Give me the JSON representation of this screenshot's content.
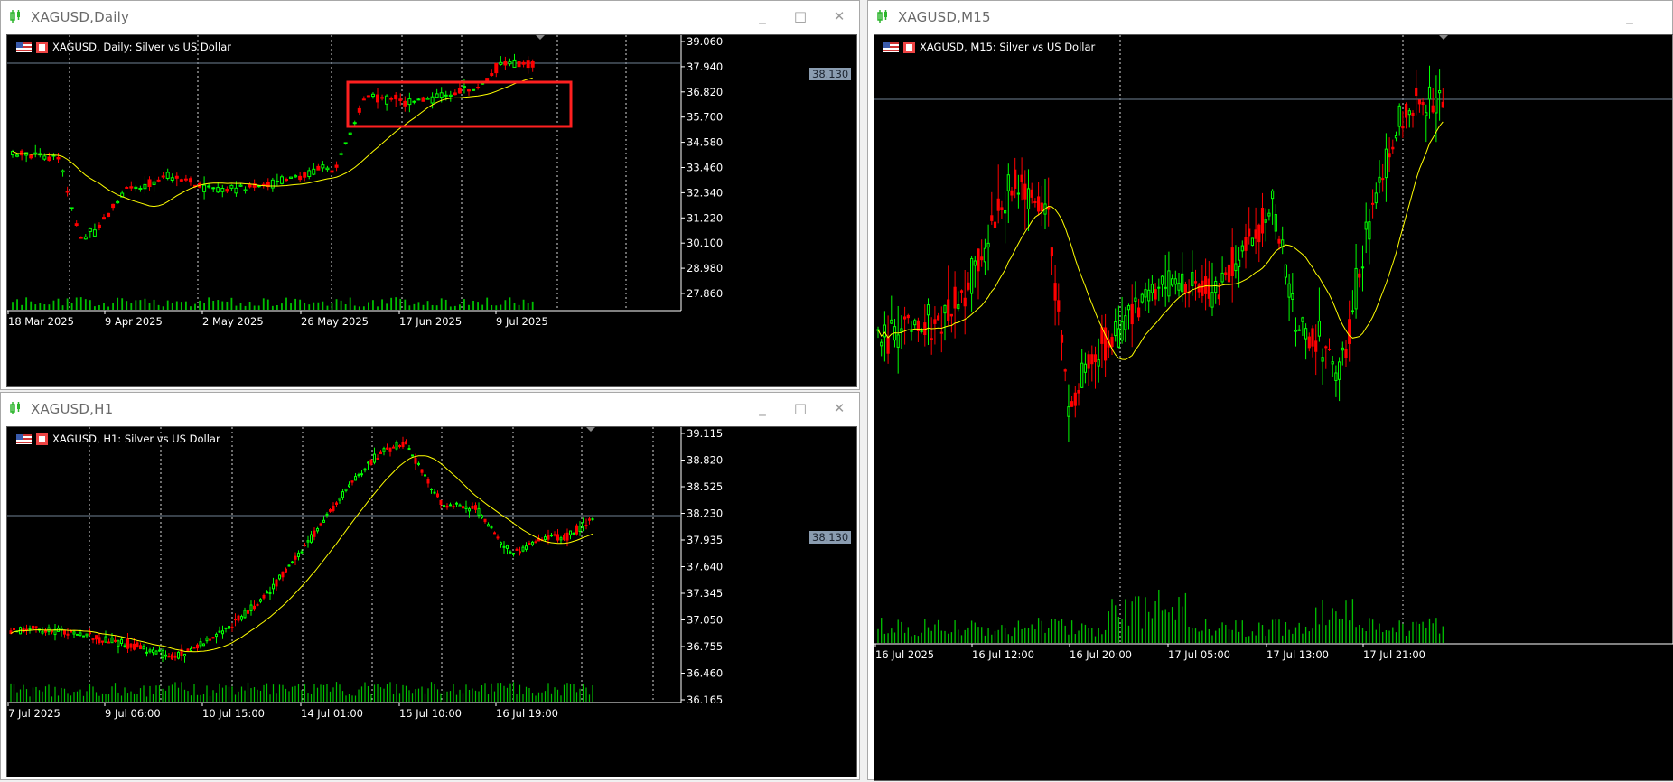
{
  "windows": {
    "daily": {
      "title": "XAGUSD,Daily",
      "label": "XAGUSD, Daily:  Silver vs US Dollar",
      "current_price": "38.130",
      "price_ticks": [
        "39.060",
        "37.940",
        "36.820",
        "35.700",
        "34.580",
        "33.460",
        "32.340",
        "31.220",
        "30.100",
        "28.980",
        "27.860"
      ],
      "time_ticks": [
        "18 Mar 2025",
        "9 Apr 2025",
        "2 May 2025",
        "26 May 2025",
        "17 Jun 2025",
        "9 Jul 2025"
      ]
    },
    "h1": {
      "title": "XAGUSD,H1",
      "label": "XAGUSD, H1:  Silver vs US Dollar",
      "current_price": "38.130",
      "price_ticks": [
        "39.115",
        "38.820",
        "38.525",
        "38.230",
        "37.935",
        "37.640",
        "37.345",
        "37.050",
        "36.755",
        "36.460",
        "36.165"
      ],
      "time_ticks": [
        "7 Jul 2025",
        "9 Jul 06:00",
        "10 Jul 15:00",
        "14 Jul 01:00",
        "15 Jul 10:00",
        "16 Jul 19:00"
      ]
    },
    "m15": {
      "title": "XAGUSD,M15",
      "label": "XAGUSD, M15:  Silver vs US Dollar",
      "time_ticks": [
        "16 Jul 2025",
        "16 Jul 12:00",
        "16 Jul 20:00",
        "17 Jul 05:00",
        "17 Jul 13:00",
        "17 Jul 21:00"
      ]
    }
  },
  "controls": {
    "minimize": "_",
    "maximize": "□",
    "close": "✕"
  },
  "icons": {
    "window": "candle-chart-icon",
    "flag": "us-flag-icon",
    "chart": "chart-type-icon"
  },
  "colors": {
    "bull": "#00ff00",
    "bear": "#ff0000",
    "ma": "#ffff00",
    "grid": "#ffffff",
    "volume": "#00c000",
    "highlight": "#ff2020",
    "price_line": "#6f8295"
  }
}
